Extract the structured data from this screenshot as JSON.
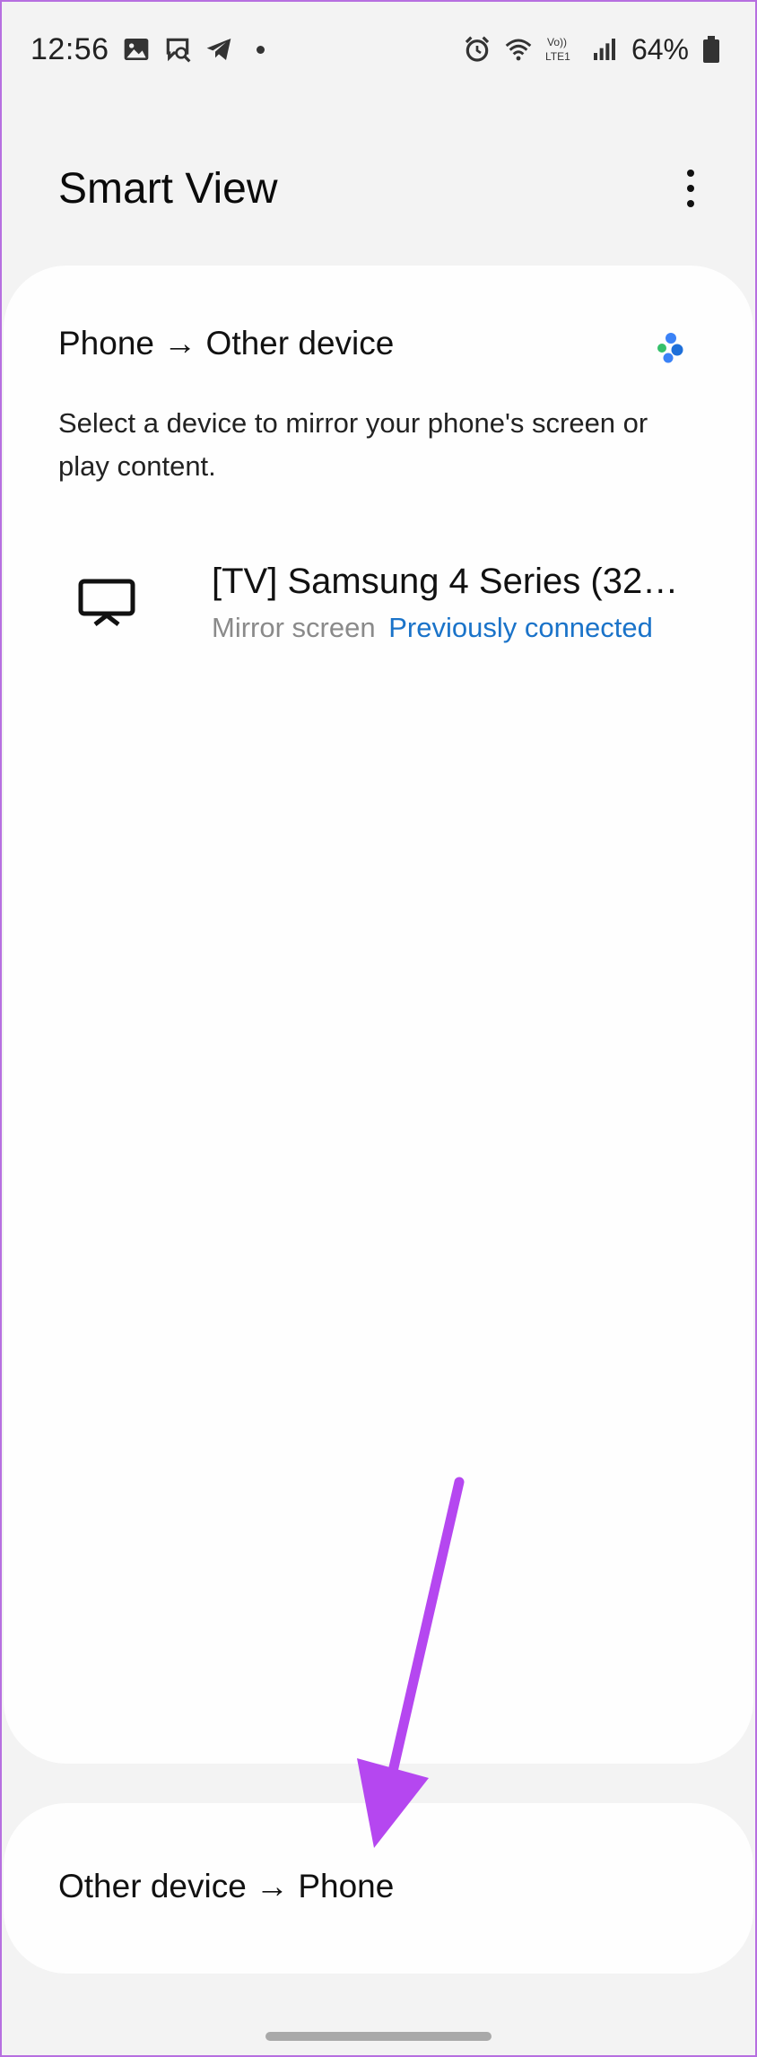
{
  "status_bar": {
    "time": "12:56",
    "left_icons": [
      "gallery-icon",
      "chat-search-icon",
      "telegram-icon",
      "notification-dot-icon"
    ],
    "right_icons": [
      "alarm-icon",
      "wifi-icon",
      "volte-lte-icon",
      "signal-icon",
      "battery-icon"
    ],
    "volte_label": "Vo))",
    "lte_label": "LTE1",
    "battery": "64%"
  },
  "header": {
    "title": "Smart View",
    "more_icon": "more-vertical-icon"
  },
  "phone_to_device": {
    "title": "Phone → Other device",
    "description": "Select a device to mirror your phone's screen or play content.",
    "scan_icon": "scanning-dots-icon",
    "scan_colors": [
      "#35c06a",
      "#3b82f6",
      "#1e6fd9"
    ],
    "devices": [
      {
        "icon": "tv-icon",
        "name": "[TV] Samsung 4 Series (32…",
        "mode": "Mirror screen",
        "status": "Previously connected"
      }
    ]
  },
  "device_to_phone": {
    "title": "Other device → Phone"
  },
  "annotation": {
    "icon": "purple-arrow-icon",
    "color": "#b547f0"
  },
  "colors": {
    "background": "#f3f3f3",
    "card": "#fefefe",
    "link_blue": "#1a73c9",
    "frame": "#b66fe0"
  }
}
